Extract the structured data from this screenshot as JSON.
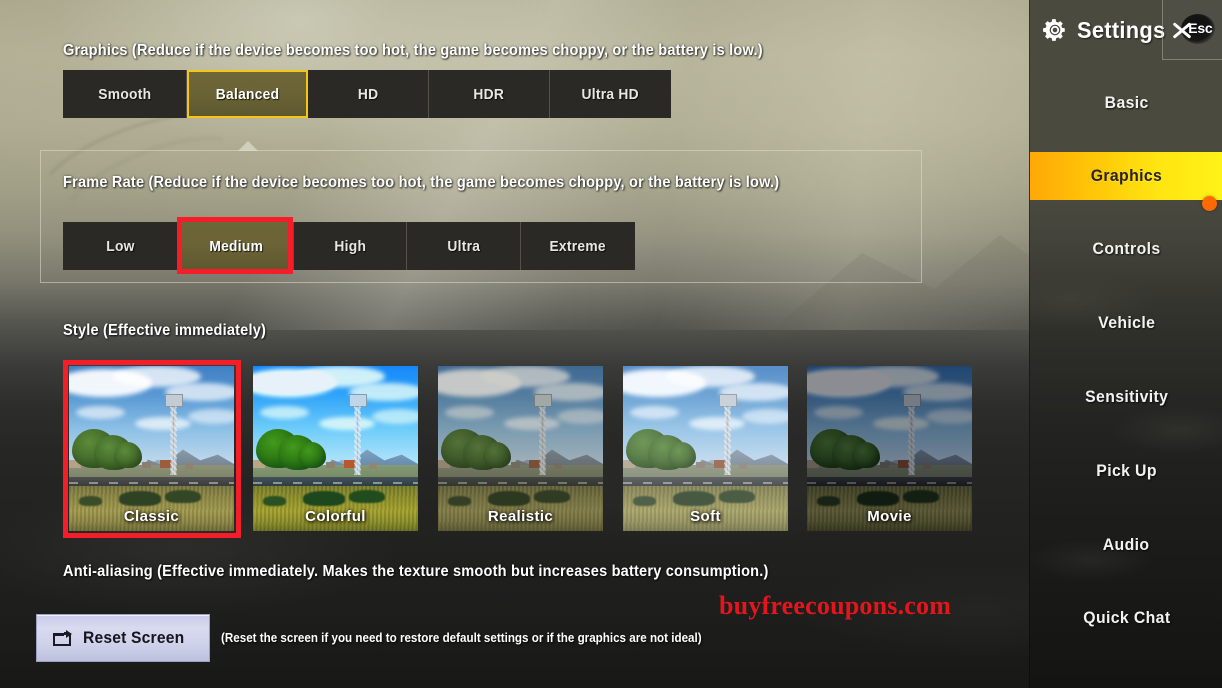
{
  "graphics_section": {
    "label": "Graphics (Reduce if the device becomes too hot, the game becomes choppy, or the battery is low.)",
    "options": [
      "Smooth",
      "Balanced",
      "HD",
      "HDR",
      "Ultra HD"
    ],
    "selected": "Balanced",
    "selected_border_color": "#f5c518",
    "selected_bg_color": "#6a6335"
  },
  "frame_rate_section": {
    "label": "Frame Rate (Reduce if the device becomes too hot, the game becomes choppy, or the battery is low.)",
    "options": [
      "Low",
      "Medium",
      "High",
      "Ultra",
      "Extreme"
    ],
    "selected": "Medium",
    "annotation_color": "#f51e28"
  },
  "style_section": {
    "label": "Style (Effective immediately)",
    "options": [
      "Classic",
      "Colorful",
      "Realistic",
      "Soft",
      "Movie"
    ],
    "selected": "Classic",
    "annotation_color": "#f51e28"
  },
  "antialiasing_section": {
    "label": "Anti-aliasing (Effective immediately. Makes the texture smooth but increases battery consumption.)"
  },
  "reset": {
    "button_label": "Reset Screen",
    "icon": "reset-screen-icon",
    "hint": "(Reset the screen if you need to restore default settings or if the graphics are not ideal)"
  },
  "watermark": {
    "text": "buyfreecoupons.com",
    "color": "#e4161b"
  },
  "sidebar": {
    "title": "Settings",
    "gear_icon": "gear-icon",
    "close_button": {
      "label": "Esc",
      "icon": "close-x-icon"
    },
    "items": [
      {
        "label": "Basic",
        "active": false,
        "badge": false
      },
      {
        "label": "Graphics",
        "active": true,
        "badge": true
      },
      {
        "label": "Controls",
        "active": false,
        "badge": false
      },
      {
        "label": "Vehicle",
        "active": false,
        "badge": false
      },
      {
        "label": "Sensitivity",
        "active": false,
        "badge": false
      },
      {
        "label": "Pick Up",
        "active": false,
        "badge": false
      },
      {
        "label": "Audio",
        "active": false,
        "badge": false
      },
      {
        "label": "Quick Chat",
        "active": false,
        "badge": false
      }
    ],
    "active_color": "#ffd20a",
    "badge_color": "#ff6a00"
  }
}
